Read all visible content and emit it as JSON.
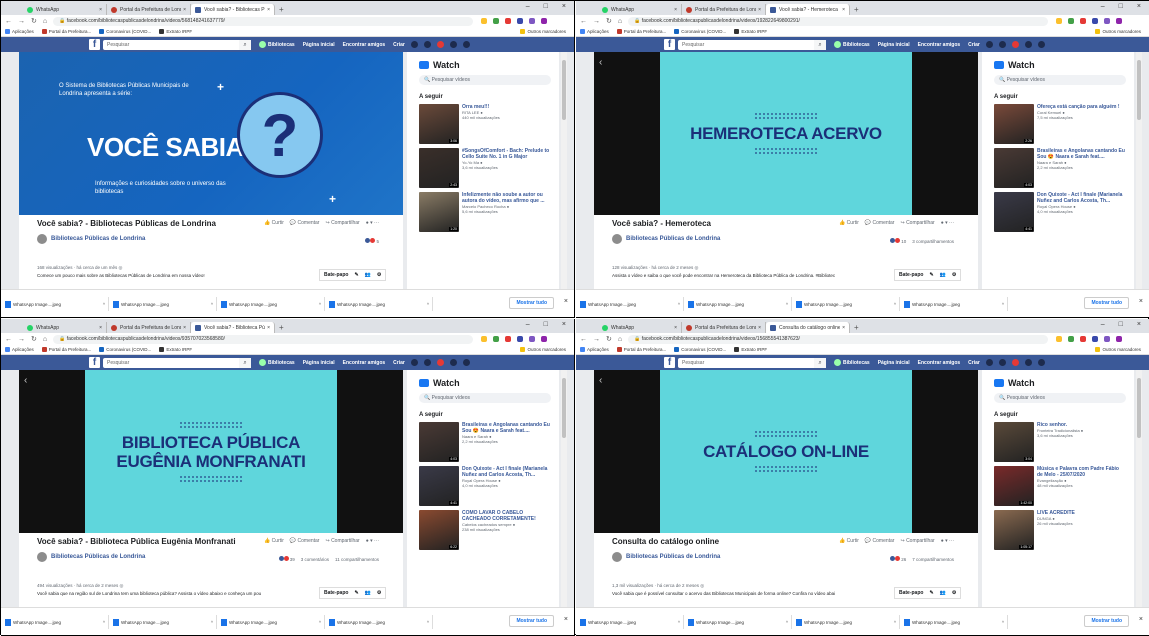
{
  "common": {
    "tabs": [
      "WhatsApp",
      "Portal da Prefeitura de Londrina"
    ],
    "bookmarks": [
      "Aplicações",
      "Portal da Prefeitura...",
      "Coronavirus (COVID...",
      "Extrato IRPF"
    ],
    "other_bookmarks": "Outros marcadores",
    "fb_search_placeholder": "Pesquisar",
    "fb_links": [
      "Bibliotecas",
      "Página inicial",
      "Encontrar amigos",
      "Criar"
    ],
    "watch_title": "Watch",
    "watch_search": "Pesquisar vídeos",
    "up_next": "A seguir",
    "page_name": "Bibliotecas Públicas de Londrina",
    "actions": [
      "Curtir",
      "Comentar",
      "Compartilhar"
    ],
    "chat_label": "Bate-papo",
    "download_file": "WhatsApp Image....jpeg",
    "show_all": "Mostrar tudo",
    "colors": {
      "fb_blue": "#3b5998",
      "video_bg": "#5fd6dc",
      "video_text": "#1b2f78",
      "link": "#385898"
    }
  },
  "panels": [
    {
      "active_tab": "Você sabia? - Bibliotecas Pú",
      "url": "facebook.com/bibliotecaspublicasdelondrina/videos/568148241637779/",
      "video_kind": "intro",
      "video_intro": "O Sistema de Bibliotecas Públicas Municipais de Londrina apresenta a série:",
      "video_big": "VOCÊ SABIA?",
      "video_sub": "Informações e curiosidades sobre o universo das bibliotecas",
      "video_title": "Você sabia? - Bibliotecas Públicas de Londrina",
      "reactions": "5",
      "comments": "",
      "shares": "",
      "meta": "168 visualizações · há cerca de um mês",
      "desc": "Comece um pouco mais sobre as Bibliotecas Públicas de Londrina em nossa vídeo!",
      "items": [
        {
          "title": "Orra meu!!!",
          "sub1": "RITA LEE",
          "sub2": "440 mil visualizações",
          "dur": "3:06",
          "color": "#6b4a3a"
        },
        {
          "title": "#SongsOfComfort - Bach: Prelude to Cello Suite No. 1 in G Major",
          "sub1": "Yo-Yo Ma",
          "sub2": "3,6 mi visualizações",
          "dur": "2:43",
          "color": "#3a2f2a"
        },
        {
          "title": "Infelizmente não soube a autor ou autora do vídeo, mas afirmo que ...",
          "sub1": "Marcelo Pacheco Rocha",
          "sub2": "5,6 mi visualizações",
          "dur": "1:20",
          "color": "#8a7c66"
        }
      ]
    },
    {
      "active_tab": "Você sabia? - Hemeroteca",
      "url": "facebook.com/bibliotecaspublicasdelondrina/videos/192822649800291/",
      "video_kind": "title",
      "video_text": "HEMEROTECA ACERVO",
      "video_title": "Você sabia? - Hemeroteca",
      "reactions": "10",
      "comments": "",
      "shares": "3 compartilhamentos",
      "meta": "128 visualizações · há cerca de 2 meses",
      "desc": "Assista o vídeo e saiba o que você pode encontrar na Hemeroteca da Biblioteca Pública de Londrina. #Bibliotec",
      "items": [
        {
          "title": "Ofereça está canção para alguém !",
          "sub1": "Coral Kemuel",
          "sub2": "7,5 mi visualizações",
          "dur": "2:26",
          "color": "#7a4a3a"
        },
        {
          "title": "Brasileiras e Angolanas cantando Eu Sou 😍 Naara e Sarah feat....",
          "sub1": "Naara e Sarah",
          "sub2": "2,2 mi visualizações",
          "dur": "4:03",
          "color": "#4a3a35"
        },
        {
          "title": "Don Quixote - Act I finale (Marianela Nuñez and Carlos Acosta, Th...",
          "sub1": "Royal Opera House",
          "sub2": "4,0 mi visualizações",
          "dur": "4:41",
          "color": "#3a3a48"
        }
      ]
    },
    {
      "active_tab": "Você sabia? - Biblioteca Públic",
      "url": "facebook.com/bibliotecaspublicasdelondrina/videos/935707023568580/",
      "video_kind": "title",
      "video_text": "BIBLIOTECA PÚBLICA EUGÊNIA MONFRANATI",
      "video_title": "Você sabia? - Biblioteca Pública Eugênia Monfranati",
      "reactions": "39",
      "comments": "3 comentários",
      "shares": "11 compartilhamentos",
      "meta": "494 visualizações · há cerca de 2 meses",
      "desc": "Você sabia que na região sul de Londrina tem uma biblioteca pública? Assista o vídeo abaixo e conheça um pou",
      "items": [
        {
          "title": "Brasileiras e Angolanas cantando Eu Sou 😍 Naara e Sarah feat....",
          "sub1": "Naara e Sarah",
          "sub2": "2,2 mi visualizações",
          "dur": "4:03",
          "color": "#4a3a35"
        },
        {
          "title": "Don Quixote - Act I finale (Marianela Nuñez and Carlos Acosta, Th...",
          "sub1": "Royal Opera House",
          "sub2": "4,0 mi visualizações",
          "dur": "4:41",
          "color": "#3a3a48"
        },
        {
          "title": "COMO LAVAR O CABELO CACHEADO CORRETAMENTE!",
          "sub1": "Cabelos cacheados sempre",
          "sub2": "238 mil visualizações",
          "dur": "6:22",
          "color": "#8a4a30"
        }
      ]
    },
    {
      "active_tab": "Consulta do catálogo online",
      "url": "facebook.com/bibliotecaspublicasdelondrina/videos/156855541387623/",
      "video_kind": "title",
      "video_text": "CATÁLOGO ON-LINE",
      "video_title": "Consulta do catálogo online",
      "reactions": "26",
      "comments": "",
      "shares": "7 compartilhamentos",
      "meta": "1,3 mil visualizações · há cerca de 2 meses",
      "desc": "Você sabia que é possível consultar o acervo das Bibliotecas Municipais de forma online? Confira no vídeo abai",
      "items": [
        {
          "title": "Rico senhor.",
          "sub1": "Fronteira Tradicionalista",
          "sub2": "3,6 mi visualizações",
          "dur": "3:04",
          "color": "#5a4a3a"
        },
        {
          "title": "Música e Palavra com Padre Fábio de Melo - 25/07/2020",
          "sub1": "Evangelização",
          "sub2": "48 mil visualizações",
          "dur": "1:42:00",
          "color": "#7a2a2a"
        },
        {
          "title": "LIVE ACREDITE",
          "sub1": "DUNGA",
          "sub2": "26 mil visualizações",
          "dur": "1:05:17",
          "color": "#8a6a50"
        }
      ]
    }
  ]
}
